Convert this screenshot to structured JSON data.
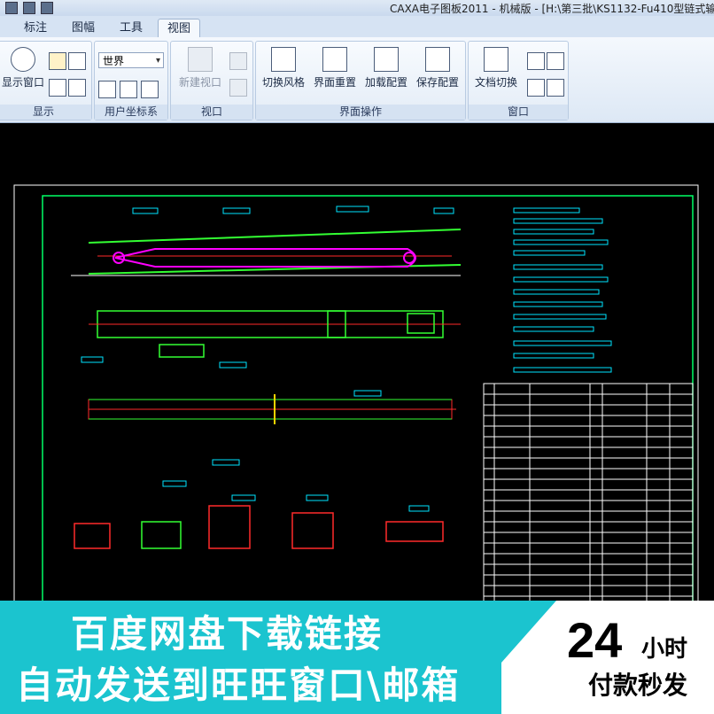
{
  "window": {
    "title": "CAXA电子图板2011 - 机械版 - [H:\\第三批\\KS1132-Fu410型链式输"
  },
  "tabs": [
    "标注",
    "图幅",
    "工具",
    "视图"
  ],
  "active_tab": "视图",
  "ribbon": {
    "display_group": {
      "label": "显示",
      "window_button": "显示窗口"
    },
    "ucs_group": {
      "label": "用户坐标系",
      "combo_value": "世界"
    },
    "viewport_group": {
      "label": "视口",
      "new_viewport": "新建视口"
    },
    "ui_group": {
      "label": "界面操作",
      "buttons": [
        "切换风格",
        "界面重置",
        "加载配置",
        "保存配置"
      ]
    },
    "window_group": {
      "label": "窗口",
      "doc_switch": "文档切换"
    }
  },
  "banner": {
    "line1": "百度网盘下载链接",
    "line2": "自动发送到旺旺窗口\\邮箱",
    "badge_number": "24",
    "badge_unit": "小时",
    "badge_sub": "付款秒发",
    "colors": {
      "banner_bg": "#1bc4cf",
      "badge_bg": "#ffffff",
      "text_white": "#ffffff"
    }
  },
  "drawing": {
    "colors": {
      "frame": "#ffffff",
      "border": "#00ff66",
      "dim": "#00e5ff",
      "center": "#ff2a2a",
      "highlight": "#ff00ff",
      "body": "#33ff33",
      "accent": "#ffd400"
    }
  }
}
